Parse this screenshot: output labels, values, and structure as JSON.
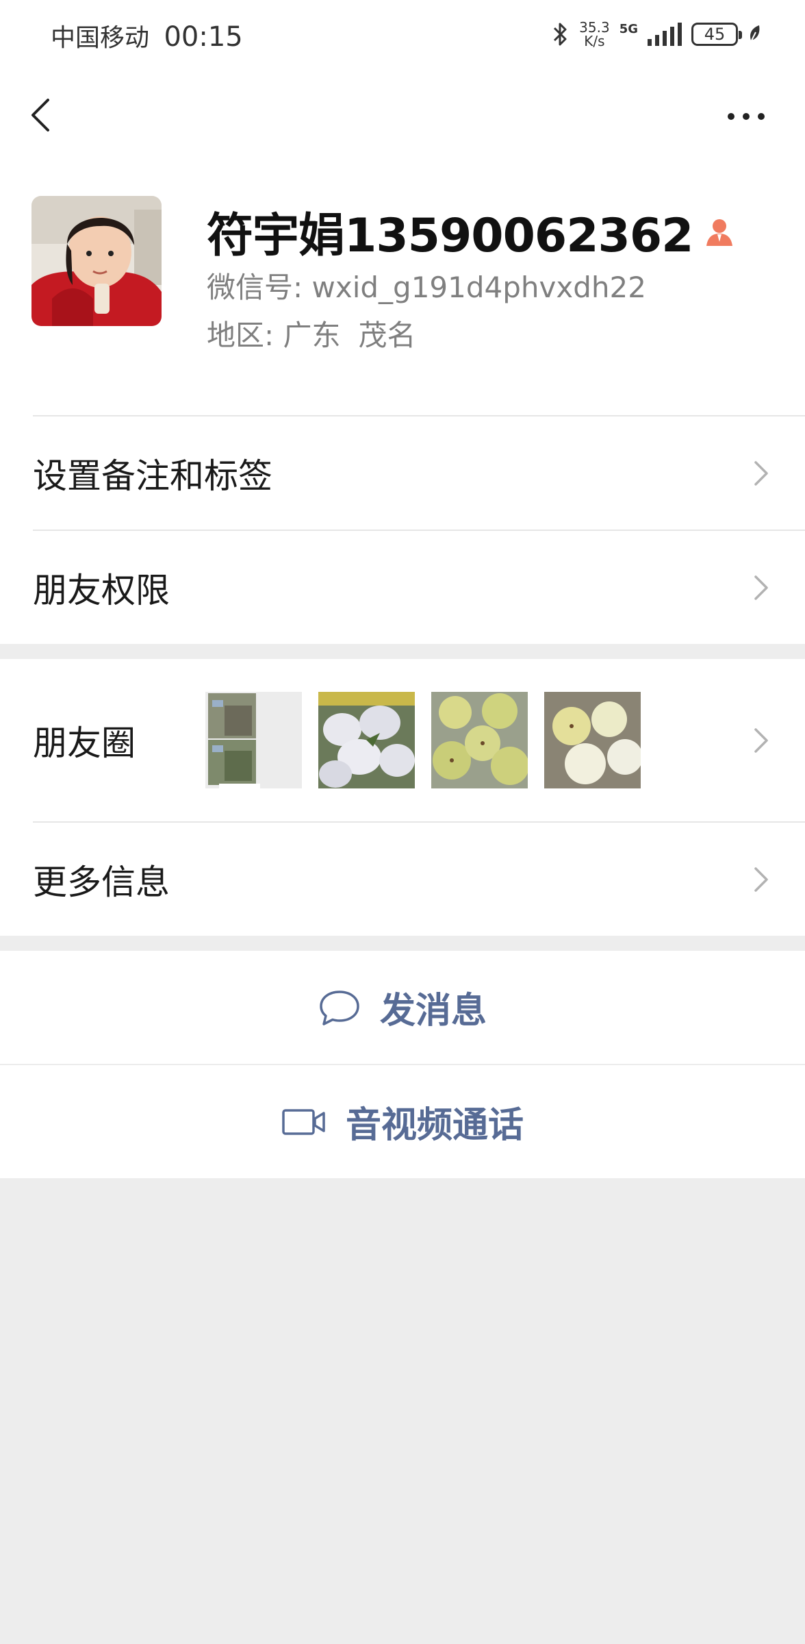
{
  "status_bar": {
    "carrier": "中国移动",
    "time": "00:15",
    "speed_value": "35.3",
    "speed_unit": "K/s",
    "network": "5G",
    "battery": "45",
    "bluetooth_icon": "bluetooth-icon",
    "leaf_icon": "leaf-icon"
  },
  "nav": {
    "back_icon": "back-icon",
    "more_icon": "more-icon"
  },
  "profile": {
    "name": "符宇娟13590062362",
    "wxid_label": "微信号:",
    "wxid_value": "wxid_g191d4phvxdh22",
    "region_label": "地区:",
    "province": "广东",
    "city": "茂名",
    "accent_color": "#f07b5f"
  },
  "menu": {
    "remarks_label": "设置备注和标签",
    "permissions_label": "朋友权限",
    "moments_label": "朋友圈",
    "more_info_label": "更多信息"
  },
  "actions": {
    "message_label": "发消息",
    "call_label": "音视频通话",
    "link_color": "#576b95"
  }
}
